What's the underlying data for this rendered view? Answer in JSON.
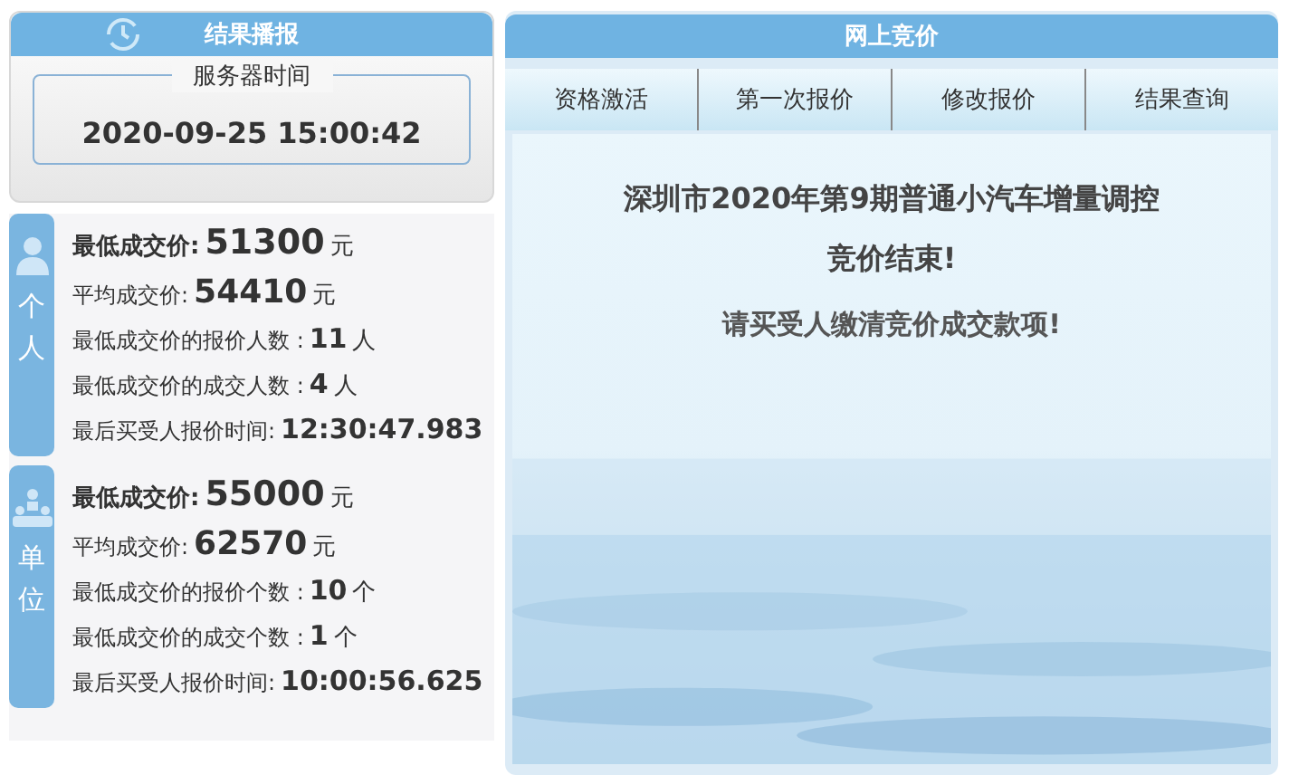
{
  "left_panel": {
    "title": "结果播报",
    "server_time": {
      "label": "服务器时间",
      "value": "2020-09-25 15:00:42"
    },
    "groups": [
      {
        "side_label": "个人",
        "kind": "person",
        "lines": [
          {
            "kind": "main",
            "label": "最低成交价:",
            "value": "51300",
            "unit": "元"
          },
          {
            "kind": "large",
            "label": "平均成交价:",
            "value": "54410",
            "unit": "元"
          },
          {
            "kind": "normal",
            "label": "最低成交价的报价人数 :",
            "value": "11",
            "unit": "人"
          },
          {
            "kind": "normal",
            "label": "最低成交价的成交人数 :",
            "value": "4",
            "unit": "人"
          },
          {
            "kind": "normal",
            "label": "最后买受人报价时间:",
            "value": "12:30:47.983"
          }
        ]
      },
      {
        "side_label": "单位",
        "kind": "org",
        "lines": [
          {
            "kind": "main",
            "label": "最低成交价:",
            "value": "55000",
            "unit": "元"
          },
          {
            "kind": "large",
            "label": "平均成交价:",
            "value": "62570",
            "unit": "元"
          },
          {
            "kind": "normal",
            "label": "最低成交价的报价个数 :",
            "value": "10",
            "unit": "个"
          },
          {
            "kind": "normal",
            "label": "最低成交价的成交个数 :",
            "value": "1",
            "unit": "个"
          },
          {
            "kind": "normal",
            "label": "最后买受人报价时间:",
            "value": "10:00:56.625"
          }
        ]
      }
    ]
  },
  "right_panel": {
    "title": "网上竞价",
    "tabs": [
      {
        "label": "资格激活",
        "selected": false
      },
      {
        "label": "第一次报价",
        "selected": false
      },
      {
        "label": "修改报价",
        "selected": false
      },
      {
        "label": "结果查询",
        "selected": false
      }
    ],
    "notice": {
      "headline": [
        "深圳市2020年第9期普通小汽车增量调控",
        "竞价结束!"
      ],
      "message": "请买受人缴清竞价成交款项!"
    }
  }
}
